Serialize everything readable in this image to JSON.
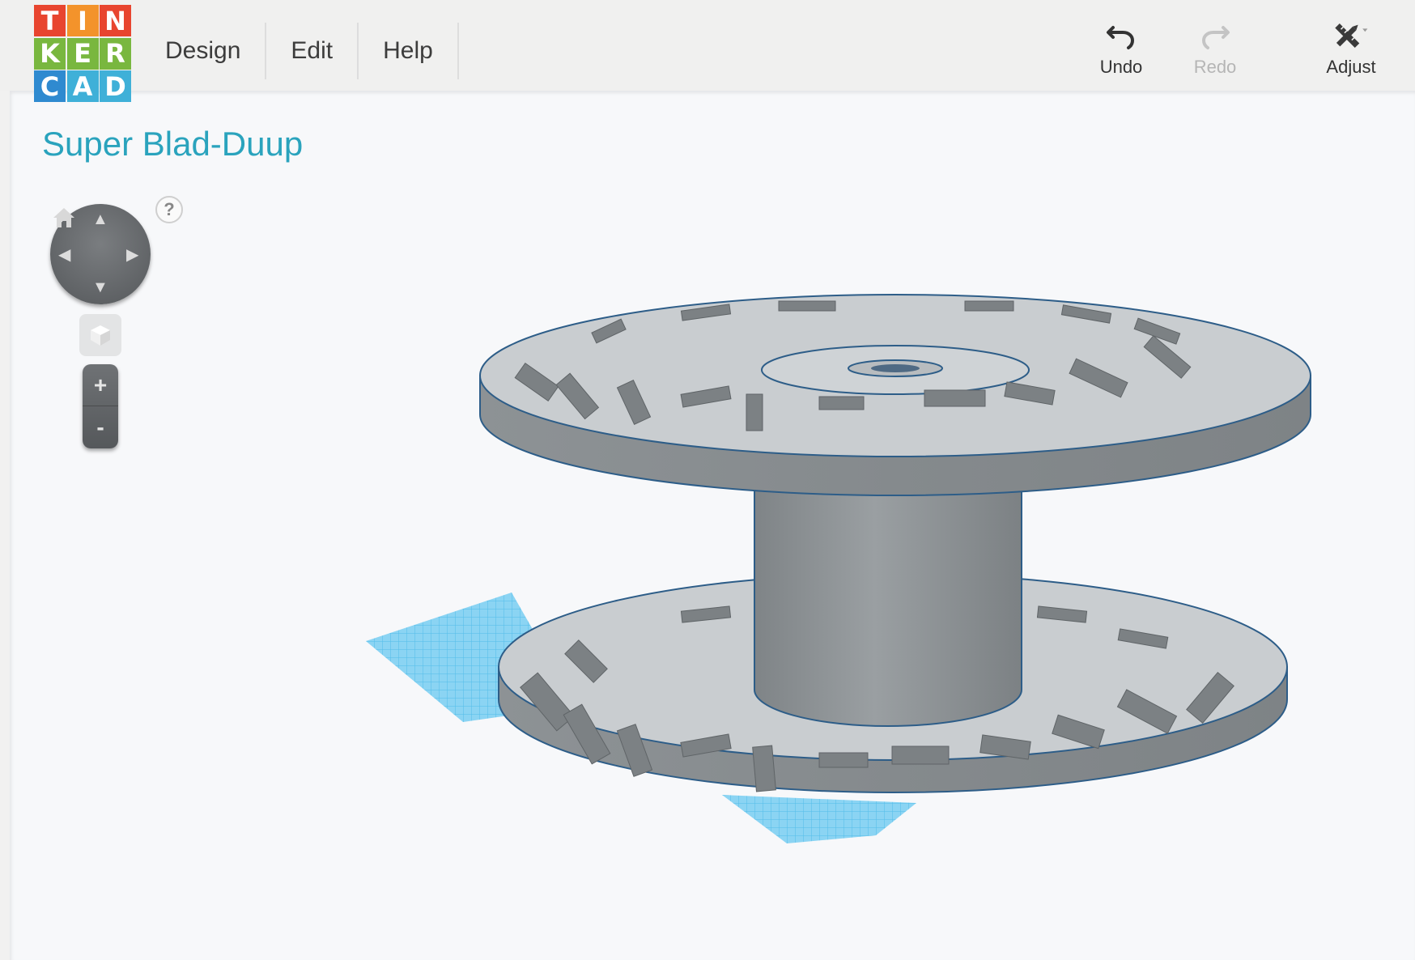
{
  "app": {
    "logo_letters": [
      "T",
      "I",
      "N",
      "K",
      "E",
      "R",
      "C",
      "A",
      "D"
    ],
    "logo_colors": [
      "#e8452f",
      "#f3932b",
      "#79b73f",
      "#2f8ad0",
      "#3fb0d8"
    ]
  },
  "menu": {
    "items": [
      {
        "label": "Design"
      },
      {
        "label": "Edit"
      },
      {
        "label": "Help"
      }
    ]
  },
  "toolbar": {
    "undo_label": "Undo",
    "redo_label": "Redo",
    "adjust_label": "Adjust",
    "undo_icon": "undo-arrow-icon",
    "redo_icon": "redo-arrow-icon",
    "adjust_icon": "ruler-pencil-icon",
    "redo_enabled": false
  },
  "design": {
    "title": "Super Blad-Duup"
  },
  "view_controls": {
    "help_label": "?",
    "zoom_in_label": "+",
    "zoom_out_label": "-"
  },
  "scene": {
    "object": "thread spool with engraved rim lettering",
    "object_color": "#9ea3a6",
    "grid_color": "#3fb6e6"
  }
}
